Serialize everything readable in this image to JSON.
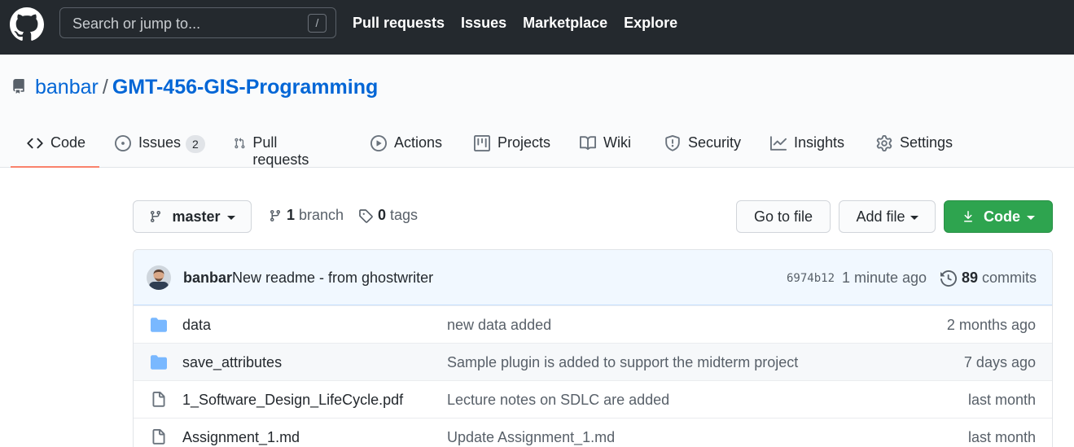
{
  "header": {
    "search_placeholder": "Search or jump to...",
    "search_shortcut": "/",
    "nav": [
      "Pull requests",
      "Issues",
      "Marketplace",
      "Explore"
    ]
  },
  "repo": {
    "owner": "banbar",
    "separator": "/",
    "name": "GMT-456-GIS-Programming"
  },
  "tabs": [
    {
      "label": "Code",
      "icon": "code-icon",
      "active": true
    },
    {
      "label": "Issues",
      "icon": "issue-icon",
      "count": "2"
    },
    {
      "label": "Pull requests",
      "icon": "pull-request-icon"
    },
    {
      "label": "Actions",
      "icon": "play-icon"
    },
    {
      "label": "Projects",
      "icon": "project-icon"
    },
    {
      "label": "Wiki",
      "icon": "book-icon"
    },
    {
      "label": "Security",
      "icon": "shield-icon"
    },
    {
      "label": "Insights",
      "icon": "graph-icon"
    },
    {
      "label": "Settings",
      "icon": "gear-icon"
    }
  ],
  "branch_bar": {
    "branch": "master",
    "branch_count": "1",
    "branch_label": "branch",
    "tag_count": "0",
    "tag_label": "tags",
    "go_to_file": "Go to file",
    "add_file": "Add file",
    "code": "Code"
  },
  "latest_commit": {
    "author": "banbar",
    "message": "New readme - from ghostwriter",
    "sha": "6974b12",
    "time": "1 minute ago",
    "commit_count": "89",
    "commit_label": "commits"
  },
  "files": [
    {
      "type": "folder",
      "name": "data",
      "message": "new data added",
      "age": "2 months ago"
    },
    {
      "type": "folder",
      "name": "save_attributes",
      "message": "Sample plugin is added to support the midterm project",
      "age": "7 days ago"
    },
    {
      "type": "file",
      "name": "1_Software_Design_LifeCycle.pdf",
      "message": "Lecture notes on SDLC are added",
      "age": "last month"
    },
    {
      "type": "file",
      "name": "Assignment_1.md",
      "message": "Update Assignment_1.md",
      "age": "last month"
    }
  ],
  "colors": {
    "header_bg": "#24292e",
    "link": "#0366d6",
    "active_tab_underline": "#f9826c",
    "primary_button": "#2ea44f",
    "folder_icon": "#79b8ff",
    "commit_bar_bg": "#f1f8ff"
  }
}
